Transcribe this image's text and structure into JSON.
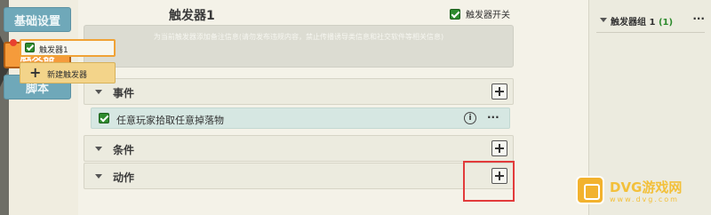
{
  "sidebar": {
    "items": [
      {
        "label": "基础设置"
      },
      {
        "label": "触发器"
      },
      {
        "label": "脚本"
      }
    ]
  },
  "header": {
    "title": "触发器1",
    "switch_label": "触发器开关"
  },
  "remark": {
    "placeholder": "为当前触发器添加备注信息(请勿发布违规内容，禁止传播诱导类信息和社交软件等相关信息)"
  },
  "sections": {
    "events": {
      "label": "事件"
    },
    "conditions": {
      "label": "条件"
    },
    "actions": {
      "label": "动作"
    }
  },
  "event_item": {
    "label": "任意玩家拾取任意掉落物"
  },
  "icons": {
    "info": "i",
    "more": "···"
  },
  "right_panel": {
    "group_title": "触发器组 1",
    "group_count": "(1)",
    "more": "···",
    "trigger_item": "触发器1",
    "new_trigger_label": "新建触发器",
    "new_trigger_plus": "+"
  },
  "watermark": {
    "text": "DVG游戏网",
    "sub": "www.dvg.com"
  },
  "colors": {
    "accent_orange": "#f59b3b",
    "nav_blue": "#6fa8b9",
    "check_green": "#2e8b2e",
    "highlight_red": "#e23b3b"
  }
}
